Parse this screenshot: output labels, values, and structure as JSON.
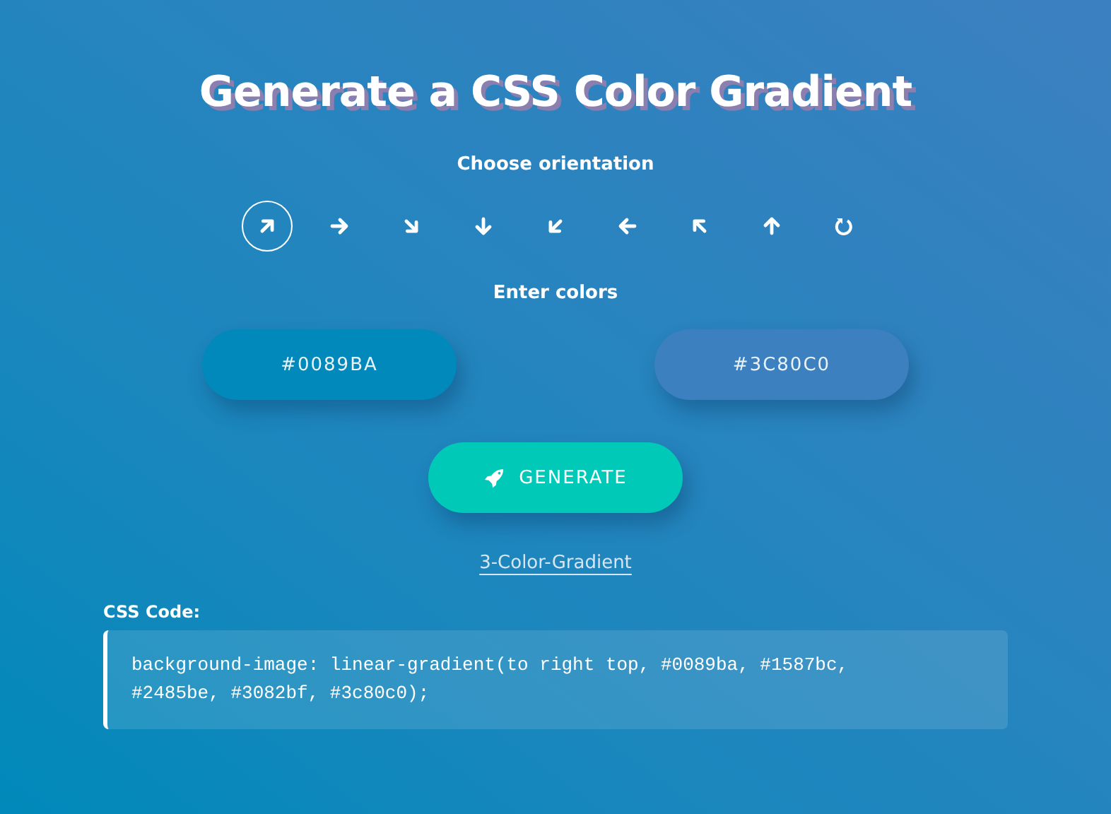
{
  "title": "Generate a CSS Color Gradient",
  "orientation": {
    "label": "Choose orientation",
    "options": [
      {
        "kind": "arrow",
        "selected": true
      },
      {
        "kind": "arrow",
        "selected": false
      },
      {
        "kind": "arrow",
        "selected": false
      },
      {
        "kind": "arrow",
        "selected": false
      },
      {
        "kind": "arrow",
        "selected": false
      },
      {
        "kind": "arrow",
        "selected": false
      },
      {
        "kind": "arrow",
        "selected": false
      },
      {
        "kind": "arrow",
        "selected": false
      },
      {
        "kind": "reset",
        "selected": false
      }
    ]
  },
  "colors": {
    "label": "Enter colors",
    "fields": [
      {
        "value": "#0089BA",
        "color": "#0089ba"
      },
      {
        "value": "#3C80C0",
        "color": "#3c80c0"
      }
    ]
  },
  "generate_button": "GENERATE",
  "link": "3-Color-Gradient",
  "code": {
    "label": "CSS Code:",
    "text": "background-image: linear-gradient(to right top, #0089ba, #1587bc, #2485be, #3082bf, #3c80c0);"
  }
}
